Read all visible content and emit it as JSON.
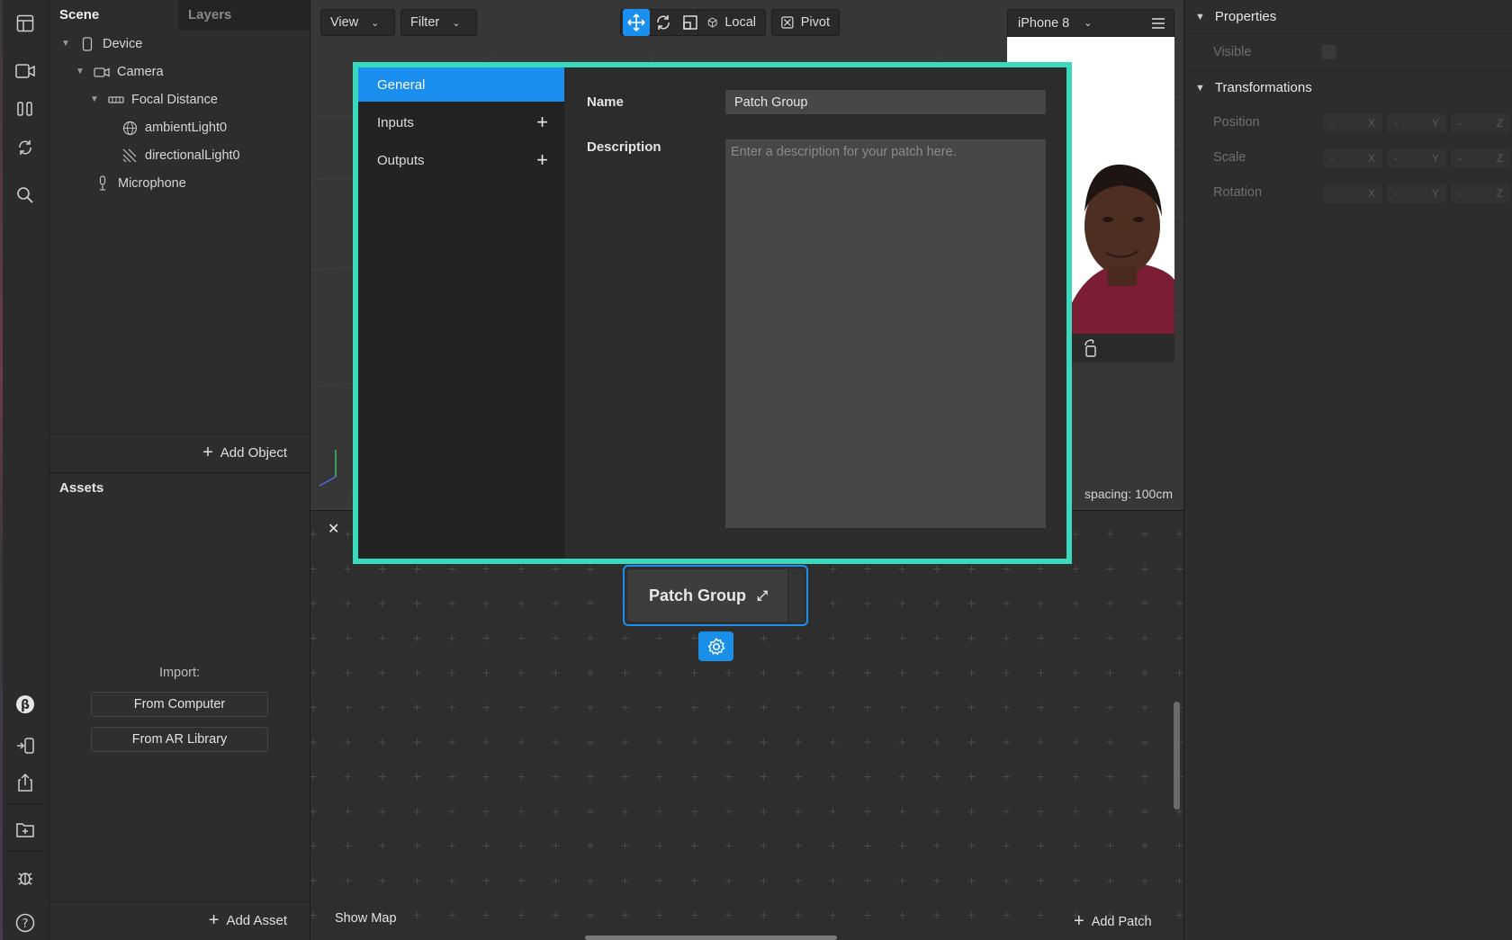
{
  "scene_panel": {
    "tabs": [
      "Scene",
      "Layers"
    ],
    "tree": [
      {
        "label": "Device",
        "icon": "phone-icon"
      },
      {
        "label": "Camera",
        "icon": "camera-icon"
      },
      {
        "label": "Focal Distance",
        "icon": "focal-distance-icon"
      },
      {
        "label": "ambientLight0",
        "icon": "ambient-light-icon"
      },
      {
        "label": "directionalLight0",
        "icon": "directional-light-icon"
      },
      {
        "label": "Microphone",
        "icon": "microphone-icon"
      }
    ],
    "add_object": "Add Object"
  },
  "assets_panel": {
    "title": "Assets",
    "import_label": "Import:",
    "from_computer": "From Computer",
    "from_ar_library": "From AR Library",
    "add_asset": "Add Asset"
  },
  "viewport": {
    "view_label": "View",
    "filter_label": "Filter",
    "local_label": "Local",
    "pivot_label": "Pivot",
    "device_label": "iPhone 8",
    "grid_spacing": "spacing: 100cm"
  },
  "patch_editor": {
    "node_label": "Patch Group",
    "show_map": "Show Map",
    "add_patch": "Add Patch"
  },
  "modal": {
    "nav": [
      {
        "label": "General",
        "active": true
      },
      {
        "label": "Inputs",
        "active": false
      },
      {
        "label": "Outputs",
        "active": false
      }
    ],
    "name_label": "Name",
    "name_value": "Patch Group",
    "description_label": "Description",
    "description_placeholder": "Enter a description for your patch here."
  },
  "properties": {
    "properties_title": "Properties",
    "visible_label": "Visible",
    "transformations_title": "Transformations",
    "rows": [
      "Position",
      "Scale",
      "Rotation"
    ],
    "placeholder_value": "-",
    "axes": [
      "X",
      "Y",
      "Z"
    ]
  },
  "colors": {
    "accent": "#1b8ff0",
    "modal_border": "#3ad9bd"
  }
}
